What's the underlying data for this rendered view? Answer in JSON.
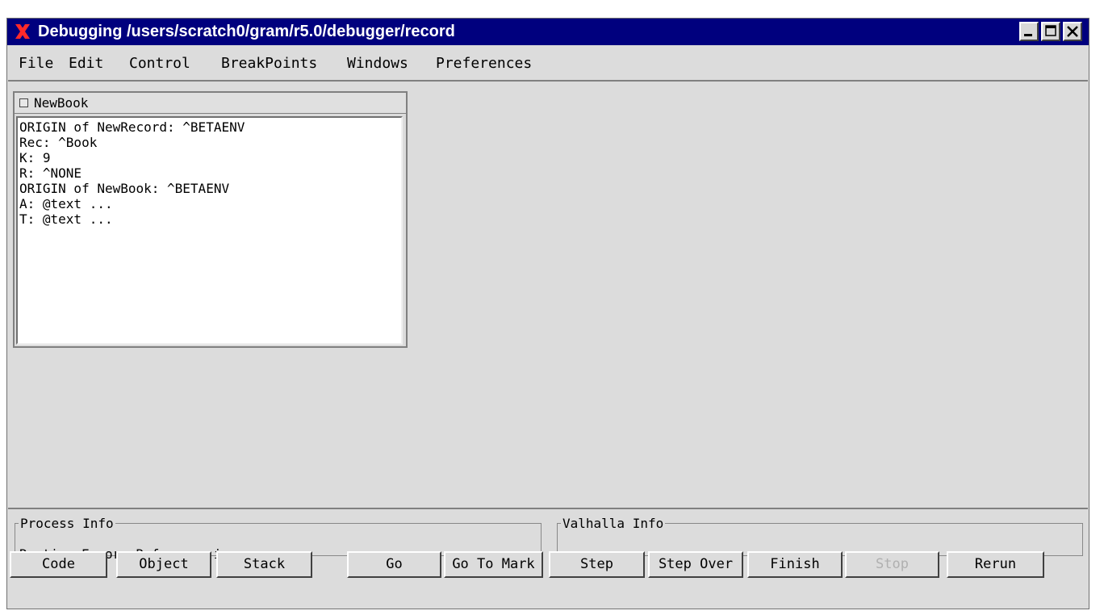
{
  "window": {
    "title": "Debugging /users/scratch0/gram/r5.0/debugger/record",
    "controls": [
      "minimize",
      "maximize",
      "close"
    ]
  },
  "menu": [
    "File",
    "Edit",
    "Control",
    "BreakPoints",
    "Windows",
    "Preferences"
  ],
  "subwindow": {
    "title": "NewBook",
    "lines": [
      "ORIGIN of NewRecord: ^BETAENV",
      "Rec: ^Book",
      "K: 9",
      "R: ^NONE",
      "ORIGIN of NewBook: ^BETAENV",
      "A: @text ...",
      "T: @text ..."
    ]
  },
  "process_info": {
    "label": "Process Info",
    "text": "Runtime Error: Reference is none"
  },
  "valhalla_info": {
    "label": "Valhalla Info",
    "text": ""
  },
  "buttons": [
    {
      "label": "Code",
      "enabled": true
    },
    {
      "label": "Object",
      "enabled": true
    },
    {
      "label": "Stack",
      "enabled": true
    },
    {
      "label": "Go",
      "enabled": true
    },
    {
      "label": "Go To Mark",
      "enabled": true
    },
    {
      "label": "Step",
      "enabled": true
    },
    {
      "label": "Step Over",
      "enabled": true
    },
    {
      "label": "Finish",
      "enabled": true
    },
    {
      "label": "Stop",
      "enabled": false
    },
    {
      "label": "Rerun",
      "enabled": true
    }
  ],
  "colors": {
    "titlebar": "#00007e",
    "window_bg": "#dcdcdc",
    "logo_x": "#ff2a2a"
  }
}
